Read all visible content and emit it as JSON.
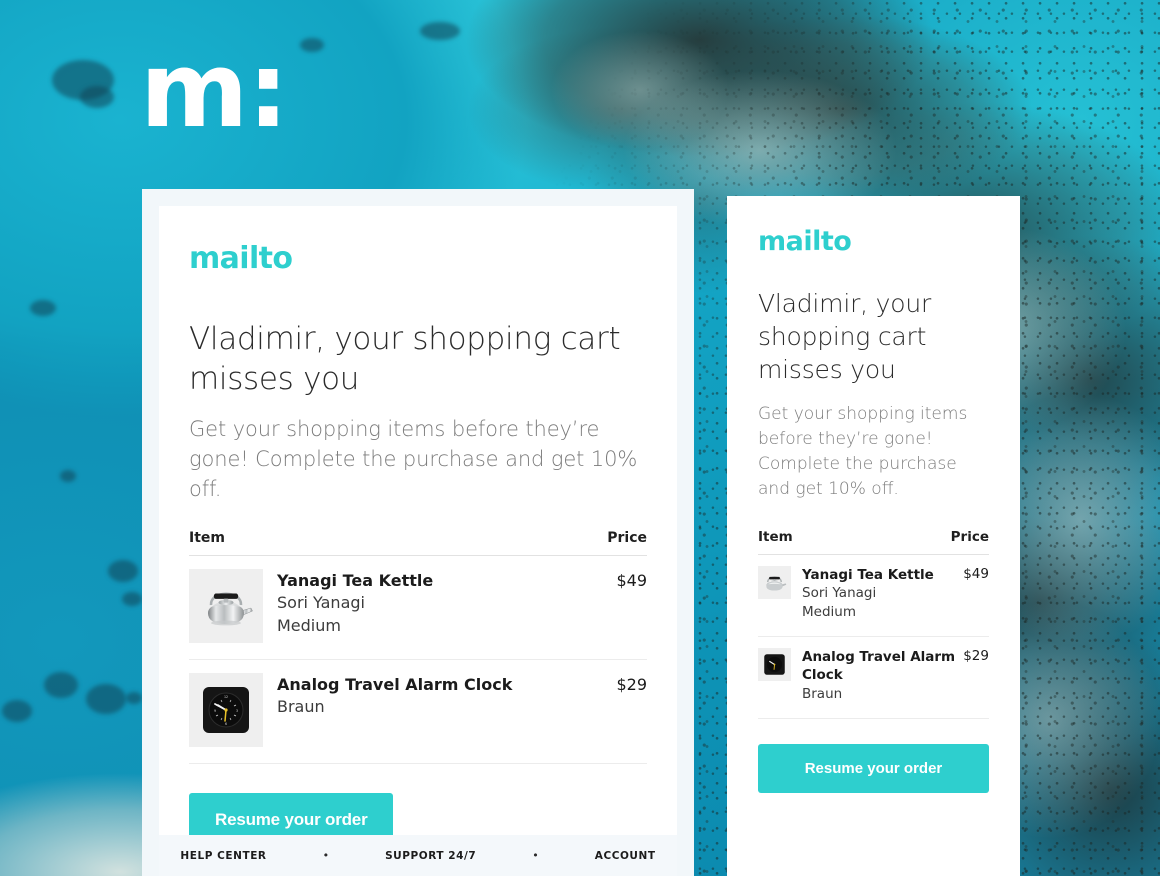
{
  "logo": {
    "wordmark": "m:"
  },
  "colors": {
    "brand_teal": "#2ecfce",
    "cta_bg": "#2ecfce",
    "cta_text": "#ffffff",
    "headline_text": "#2b2b2b",
    "subtext": "#7b7b7b",
    "card_bg": "#ffffff",
    "card_frame": "#f2f7fa",
    "footer_bg": "#f4f8fb",
    "thumb_bg": "#efefef",
    "divider": "#ececec"
  },
  "email": {
    "brand": "mailto",
    "headline": "Vladimir, your shopping cart misses you",
    "subtext": "Get your shopping items before they’re gone! Complete the purchase and get 10% off.",
    "table": {
      "columns": [
        "Item",
        "Price"
      ],
      "items": [
        {
          "name": "Yanagi Tea Kettle",
          "brand": "Sori Yanagi",
          "size": "Medium",
          "price": "$49",
          "thumb": "tea-kettle-image"
        },
        {
          "name": "Analog Travel Alarm Clock",
          "brand": "Braun",
          "size": "",
          "price": "$29",
          "thumb": "alarm-clock-image"
        }
      ]
    },
    "cta_label": "Resume your order",
    "footer": {
      "links": [
        "HELP CENTER",
        "SUPPORT 24/7",
        "ACCOUNT"
      ],
      "separator": "•"
    }
  }
}
